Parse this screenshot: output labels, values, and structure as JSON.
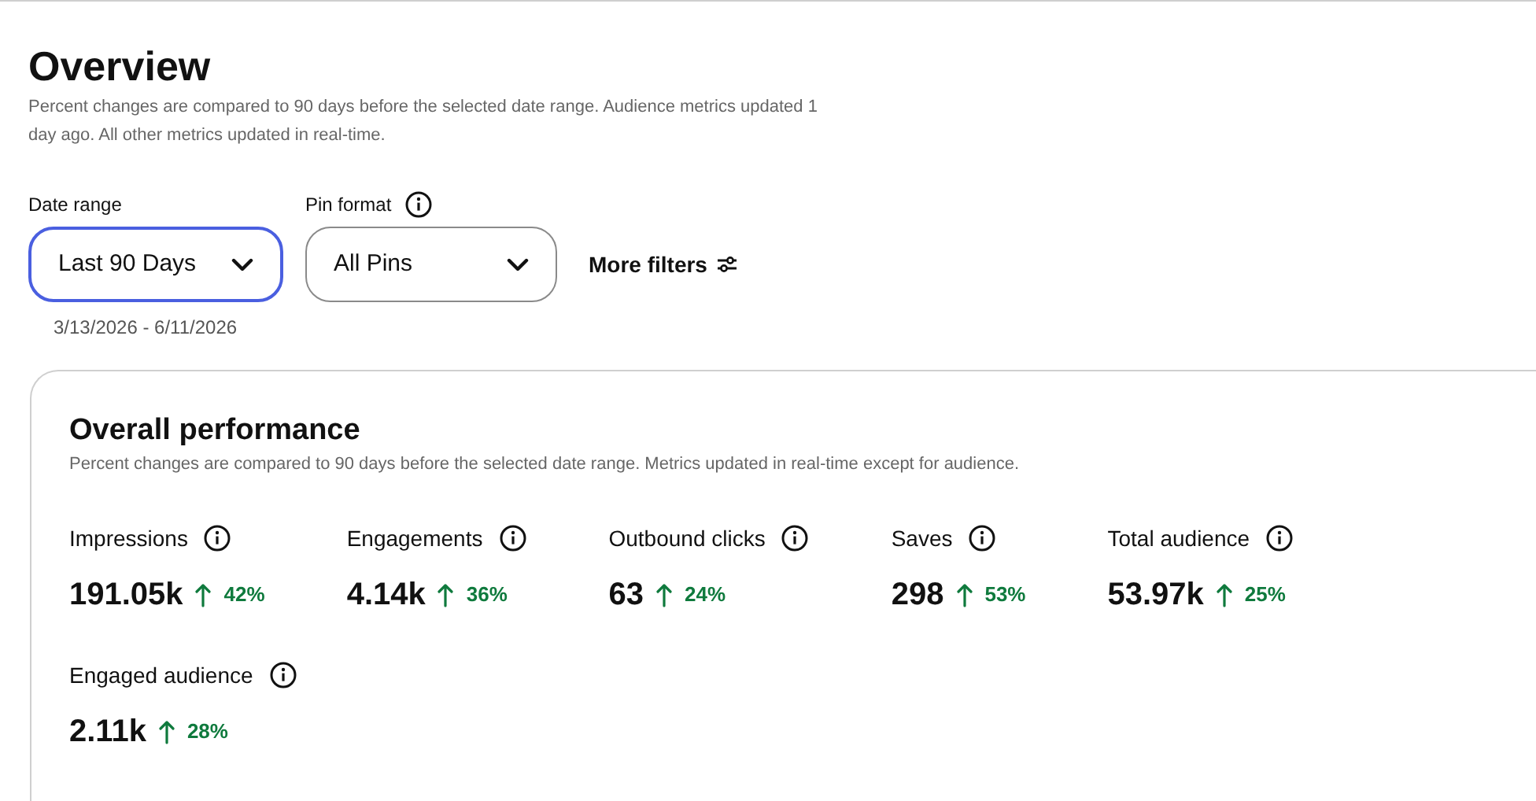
{
  "header": {
    "title": "Overview",
    "subtitle": "Percent changes are compared to 90 days before the selected date range. Audience metrics updated 1 day ago. All other metrics updated in real-time."
  },
  "filters": {
    "date_range": {
      "label": "Date range",
      "value": "Last 90 Days",
      "focused": true,
      "caption": "3/13/2026 - 6/11/2026"
    },
    "pin_format": {
      "label": "Pin format",
      "value": "All Pins",
      "focused": false
    },
    "more_filters": "More filters"
  },
  "performance": {
    "title": "Overall performance",
    "subtitle": "Percent changes are compared to 90 days before the selected date range. Metrics updated in real-time except for audience.",
    "metrics": [
      {
        "label": "Impressions",
        "value": "191.05k",
        "change": "42%",
        "kind": "increase"
      },
      {
        "label": "Engagements",
        "value": "4.14k",
        "change": "36%",
        "kind": "increase"
      },
      {
        "label": "Outbound clicks",
        "value": "63",
        "change": "24%",
        "kind": "increase"
      },
      {
        "label": "Saves",
        "value": "298",
        "change": "53%",
        "kind": "increase"
      },
      {
        "label": "Total audience",
        "value": "53.97k",
        "change": "25%",
        "kind": "increase"
      },
      {
        "label": "Engaged audience",
        "value": "2.11k",
        "change": "28%",
        "kind": "increase"
      }
    ]
  }
}
